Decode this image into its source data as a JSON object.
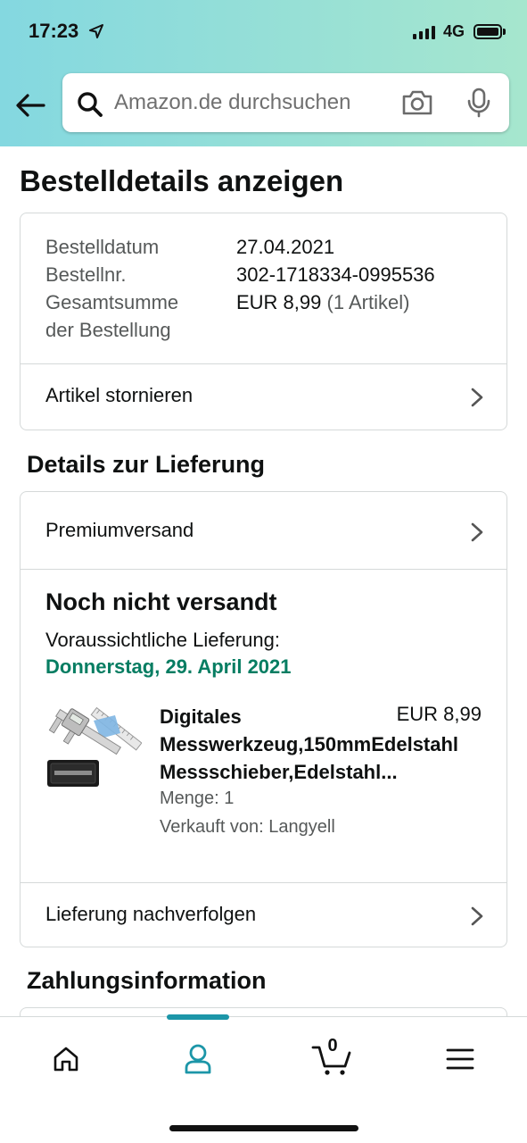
{
  "status_bar": {
    "time": "17:23",
    "network": "4G"
  },
  "search": {
    "placeholder": "Amazon.de durchsuchen"
  },
  "page": {
    "title": "Bestelldetails anzeigen"
  },
  "order_summary": {
    "date_label": "Bestelldatum",
    "date_value": "27.04.2021",
    "number_label": "Bestellnr.",
    "number_value": "302-1718334-0995536",
    "total_label_line1": "Gesamtsumme",
    "total_label_line2": "der Bestellung",
    "total_value": "EUR 8,99",
    "total_items": "(1 Artikel)",
    "cancel_label": "Artikel stornieren"
  },
  "delivery": {
    "section_title": "Details zur Lieferung",
    "shipping_method": "Premiumversand",
    "status": "Noch nicht versandt",
    "expected_label": "Voraussichtliche Lieferung:",
    "expected_date": "Donnerstag, 29. April 2021",
    "product": {
      "title_line1": "Digitales",
      "title_line2": "Messwerkzeug,150mmEdelstahl",
      "title_line3": "Messschieber,Edelstahl...",
      "price": "EUR 8,99",
      "quantity": "Menge: 1",
      "seller": "Verkauft von: Langyell"
    },
    "track_label": "Lieferung nachverfolgen"
  },
  "payment": {
    "section_title": "Zahlungsinformation"
  },
  "bottom_nav": {
    "cart_count": "0",
    "active": "account"
  },
  "colors": {
    "accent": "#1c96a8",
    "delivery_green": "#067d62",
    "header_gradient_start": "#84d8e0",
    "header_gradient_end": "#a6e6ce"
  }
}
